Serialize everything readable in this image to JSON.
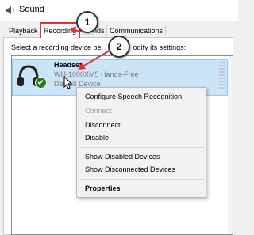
{
  "window": {
    "title": "Sound"
  },
  "tabs": [
    {
      "label": "Playback"
    },
    {
      "label": "Recording"
    },
    {
      "label": "nds"
    },
    {
      "label": "Communications"
    }
  ],
  "instruction": "Select a recording device bel",
  "instruction_tail": "odify its settings:",
  "device": {
    "name": "Headset",
    "description": "WH-1000XM5 Hands-Free",
    "status": "Default Device",
    "icon": "headset-icon",
    "status_icon": "green-check-icon"
  },
  "context_menu": {
    "items": [
      {
        "label": "Configure Speech Recognition",
        "enabled": true
      },
      {
        "label": "Connect",
        "enabled": false
      },
      {
        "label": "Disconnect",
        "enabled": true
      },
      {
        "label": "Disable",
        "enabled": true
      },
      {
        "label": "Show Disabled Devices",
        "enabled": true
      },
      {
        "label": "Show Disconnected Devices",
        "enabled": true
      },
      {
        "label": "Properties",
        "enabled": true,
        "bold": true
      }
    ]
  },
  "annotations": [
    {
      "label": "1"
    },
    {
      "label": "2"
    }
  ],
  "colors": {
    "highlight": "#cce4f7",
    "annotation_red": "#e03131",
    "default_check": "#1e7f1e"
  }
}
